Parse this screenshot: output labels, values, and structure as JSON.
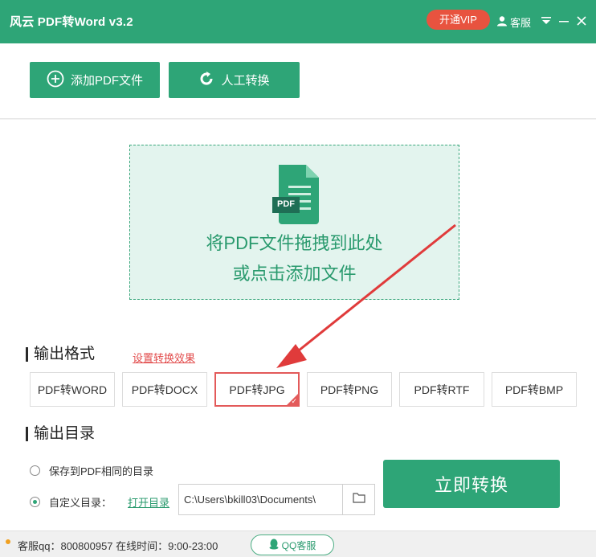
{
  "app": {
    "title": "风云 PDF转Word v3.2",
    "vip_label": "开通VIP",
    "service_label": "客服"
  },
  "toolbar": {
    "add_pdf_label": "添加PDF文件",
    "manual_convert_label": "人工转换"
  },
  "dropzone": {
    "badge": "PDF",
    "line1": "将PDF文件拖拽到此处",
    "line2": "或点击添加文件"
  },
  "output_format": {
    "title": "输出格式",
    "settings_link": "设置转换效果",
    "options": [
      "PDF转WORD",
      "PDF转DOCX",
      "PDF转JPG",
      "PDF转PNG",
      "PDF转RTF",
      "PDF转BMP"
    ],
    "selected": "PDF转JPG"
  },
  "output_dir": {
    "title": "输出目录",
    "same_dir_label": "保存到PDF相同的目录",
    "custom_dir_label": "自定义目录：",
    "open_dir_link": "打开目录",
    "path_value": "C:\\Users\\bkill03\\Documents\\",
    "selected": "custom"
  },
  "convert_label": "立即转换",
  "status": {
    "text": "客服qq：800800957 在线时间：9:00-23:00",
    "qq_service_label": "QQ客服"
  },
  "colors": {
    "brand_green": "#2ea577",
    "vip_red": "#e8533f",
    "annotation_red": "#e03b3b"
  }
}
